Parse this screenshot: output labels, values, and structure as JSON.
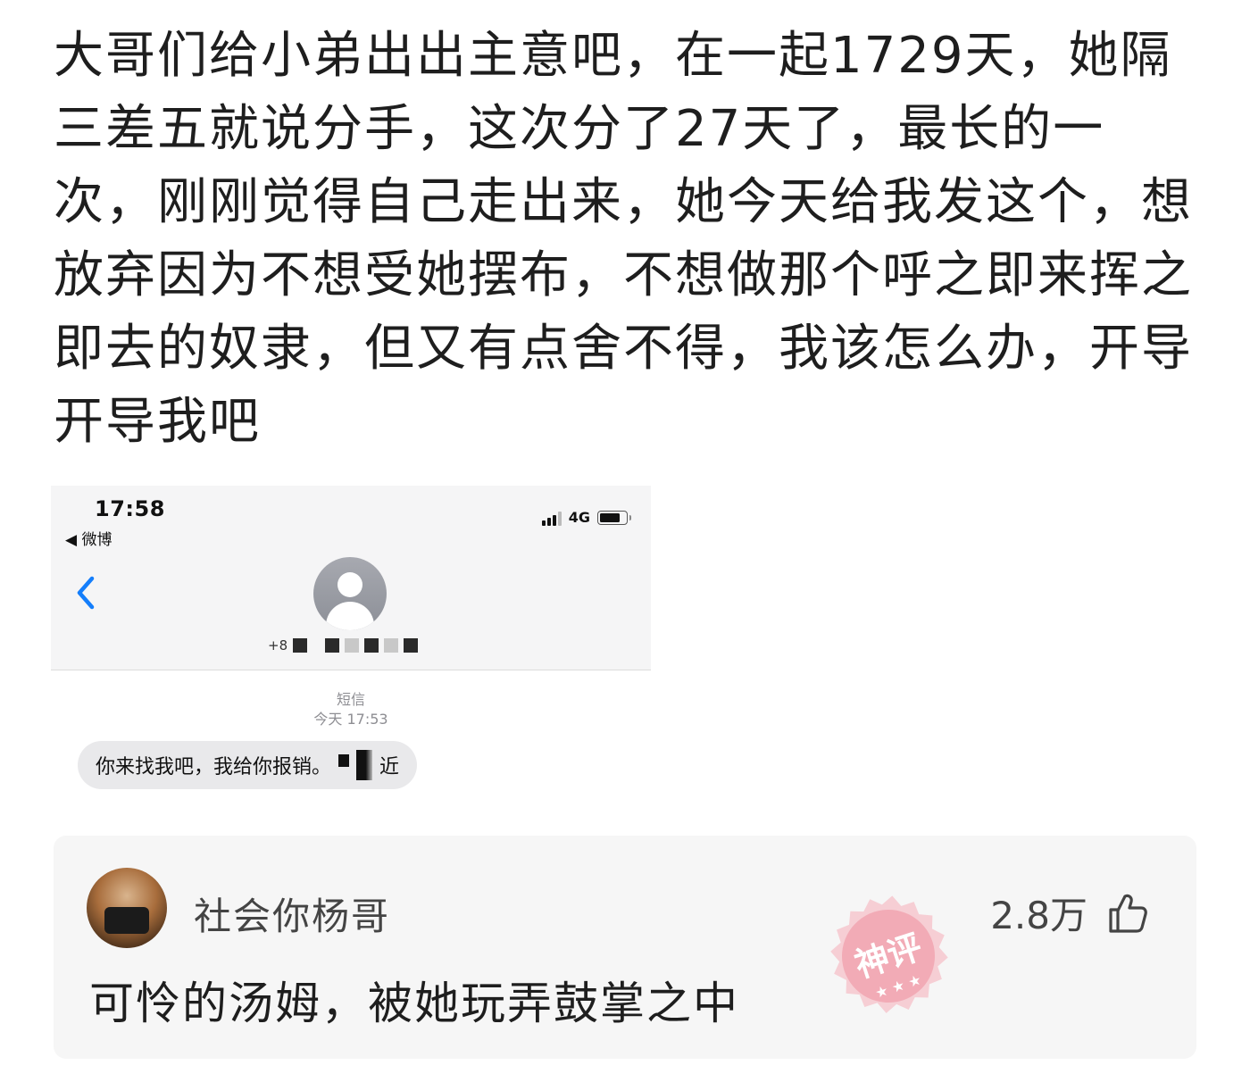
{
  "post": {
    "text": "大哥们给小弟出出主意吧，在一起1729天，她隔三差五就说分手，这次分了27天了，最长的一次，刚刚觉得自己走出来，她今天给我发这个，想放弃因为不想受她摆布，不想做那个呼之即来挥之即去的奴隶，但又有点舍不得，我该怎么办，开导开导我吧"
  },
  "screenshot": {
    "time": "17:58",
    "back_app": "◀ 微博",
    "network": "4G",
    "contact_prefix": "+8",
    "message_type": "短信",
    "message_time": "今天 17:53",
    "message_text": "你来找我吧，我给你报销。",
    "message_suffix": "近"
  },
  "comment": {
    "username": "社会你杨哥",
    "likes": "2.8万",
    "text": "可怜的汤姆，被她玩弄鼓掌之中",
    "stamp_label": "神评"
  },
  "colors": {
    "ios_blue": "#147efb",
    "stamp_pink": "#f2a7b2",
    "bubble_gray": "#e9e9eb"
  }
}
